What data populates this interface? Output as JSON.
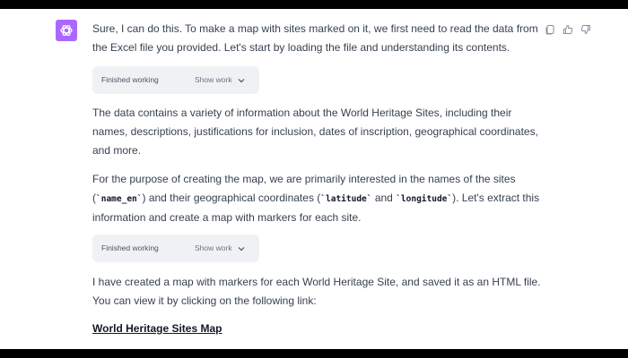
{
  "message": {
    "para1": "Sure, I can do this. To make a map with sites marked on it, we first need to read the data from the Excel file you provided. Let's start by loading the file and understanding its contents.",
    "status1": "Finished working",
    "show_work1": "Show work",
    "para2": "The data contains a variety of information about the World Heritage Sites, including their names, descriptions, justifications for inclusion, dates of inscription, geographical coordinates, and more.",
    "para3_a": "For the purpose of creating the map, we are primarily interested in the names of the sites (",
    "code1": "`name_en`",
    "para3_b": ") and their geographical coordinates (",
    "code2": "`latitude`",
    "para3_c": " and ",
    "code3": "`longitude`",
    "para3_d": "). Let's extract this information and create a map with markers for each site.",
    "status2": "Finished working",
    "show_work2": "Show work",
    "para4": "I have created a map with markers for each World Heritage Site, and saved it as an HTML file. You can view it by clicking on the following link:",
    "link": "World Heritage Sites Map"
  },
  "colors": {
    "avatar_bg": "#ab68ff",
    "text": "#374151",
    "chip_bg": "#f0f1f4"
  },
  "icons": {
    "avatar": "openai-logo-icon",
    "copy": "copy-icon",
    "like": "thumbs-up-icon",
    "dislike": "thumbs-down-icon",
    "show_work": "chevron-down-icon"
  }
}
